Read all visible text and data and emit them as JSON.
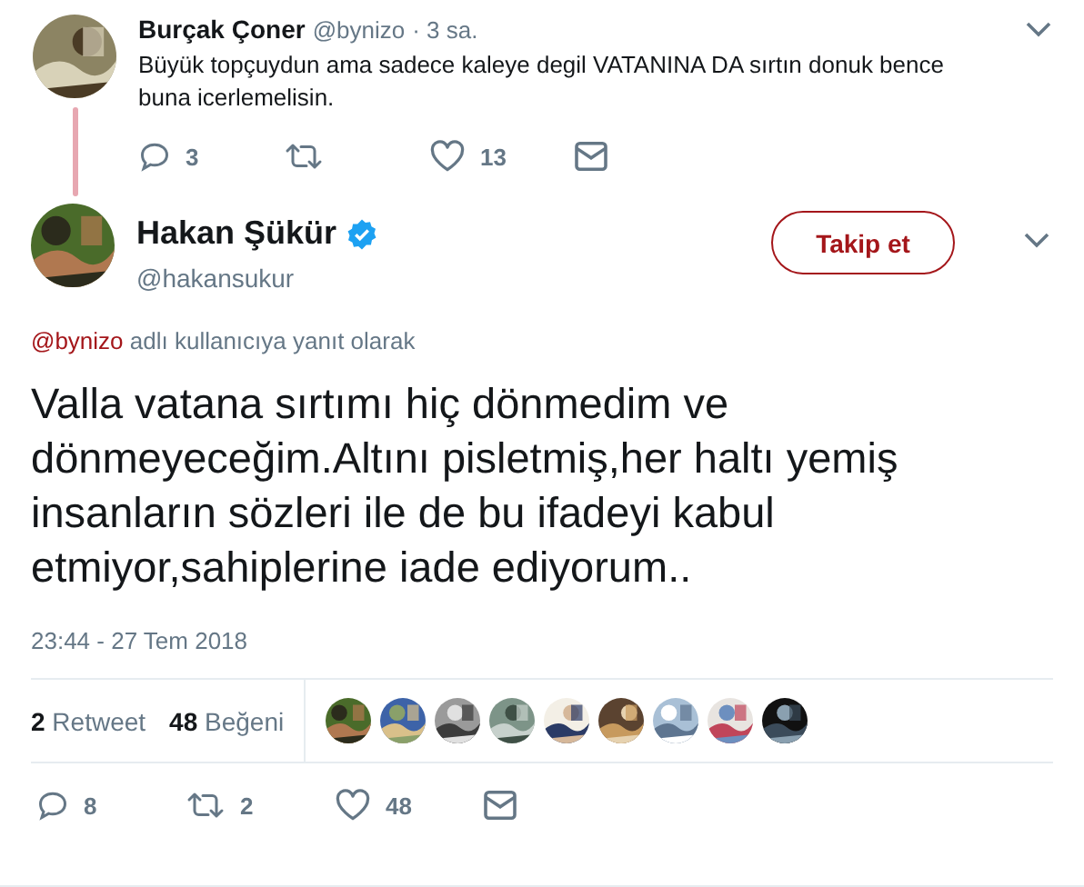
{
  "parent_tweet": {
    "author": "Burçak Çoner",
    "handle": "@bynizo",
    "time": "· 3 sa.",
    "text": "Büyük topçuydun ama sadece kaleye degil VATANINA DA sırtın donuk bence buna icerlemelisin.",
    "actions": [
      {
        "kind": "reply",
        "count": "3"
      },
      {
        "kind": "retweet"
      },
      {
        "kind": "like",
        "count": "13"
      },
      {
        "kind": "message"
      }
    ]
  },
  "tweet": {
    "author": "Hakan Şükür",
    "verified": true,
    "handle": "@hakansukur",
    "follow_button": "Takip et",
    "reply_to": {
      "handle": "@bynizo",
      "text": "adlı kullanıcıya yanıt olarak"
    },
    "text": "Valla vatana sırtımı hiç dönmedim ve dönmeyeceğim.Altını pisletmiş,her haltı yemiş insanların sözleri ile de bu ifadeyi kabul etmiyor,sahiplerine iade ediyorum..",
    "timestamp": "23:44 - 27 Tem 2018",
    "stats": [
      {
        "count": "2",
        "label": "Retweet"
      },
      {
        "count": "48",
        "label": "Beğeni"
      }
    ],
    "actions": [
      {
        "kind": "reply",
        "count": "8"
      },
      {
        "kind": "retweet",
        "count": "2"
      },
      {
        "kind": "like",
        "count": "48"
      },
      {
        "kind": "message"
      }
    ]
  }
}
